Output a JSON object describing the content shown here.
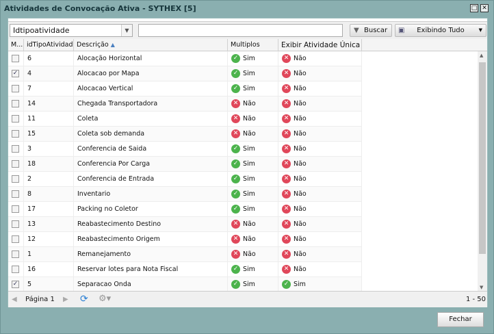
{
  "window": {
    "title": "Atividades de Convocação Ativa - SYTHEX [5]"
  },
  "toolbar": {
    "field_select": "Idtipoatividade",
    "search_value": "",
    "buscar_label": "Buscar",
    "filter_label": "Exibindo Tudo"
  },
  "columns": [
    "M...",
    "idTipoAtividade",
    "Descrição",
    "Multiplos",
    "Exibir Atividade Única"
  ],
  "rows": [
    {
      "checked": false,
      "id": "6",
      "desc": "Alocação Horizontal",
      "multiplos": "Sim",
      "unica": "Não"
    },
    {
      "checked": true,
      "id": "4",
      "desc": "Alocacao por Mapa",
      "multiplos": "Sim",
      "unica": "Não"
    },
    {
      "checked": false,
      "id": "7",
      "desc": "Alocacao Vertical",
      "multiplos": "Sim",
      "unica": "Não"
    },
    {
      "checked": false,
      "id": "14",
      "desc": "Chegada Transportadora",
      "multiplos": "Não",
      "unica": "Não"
    },
    {
      "checked": false,
      "id": "11",
      "desc": "Coleta",
      "multiplos": "Não",
      "unica": "Não"
    },
    {
      "checked": false,
      "id": "15",
      "desc": "Coleta sob demanda",
      "multiplos": "Não",
      "unica": "Não"
    },
    {
      "checked": false,
      "id": "3",
      "desc": "Conferencia de Saida",
      "multiplos": "Sim",
      "unica": "Não"
    },
    {
      "checked": false,
      "id": "18",
      "desc": "Conferencia Por Carga",
      "multiplos": "Sim",
      "unica": "Não"
    },
    {
      "checked": false,
      "id": "2",
      "desc": "Conferencia de Entrada",
      "multiplos": "Sim",
      "unica": "Não"
    },
    {
      "checked": false,
      "id": "8",
      "desc": "Inventario",
      "multiplos": "Sim",
      "unica": "Não"
    },
    {
      "checked": false,
      "id": "17",
      "desc": "Packing no Coletor",
      "multiplos": "Sim",
      "unica": "Não"
    },
    {
      "checked": false,
      "id": "13",
      "desc": "Reabastecimento Destino",
      "multiplos": "Não",
      "unica": "Não"
    },
    {
      "checked": false,
      "id": "12",
      "desc": "Reabastecimento Origem",
      "multiplos": "Não",
      "unica": "Não"
    },
    {
      "checked": false,
      "id": "1",
      "desc": "Remanejamento",
      "multiplos": "Não",
      "unica": "Não"
    },
    {
      "checked": false,
      "id": "16",
      "desc": "Reservar lotes para Nota Fiscal",
      "multiplos": "Sim",
      "unica": "Não"
    },
    {
      "checked": true,
      "id": "5",
      "desc": "Separacao  Onda",
      "multiplos": "Sim",
      "unica": "Sim"
    }
  ],
  "pager": {
    "page_label": "Página 1",
    "range": "1 - 50"
  },
  "footer": {
    "close_label": "Fechar"
  }
}
